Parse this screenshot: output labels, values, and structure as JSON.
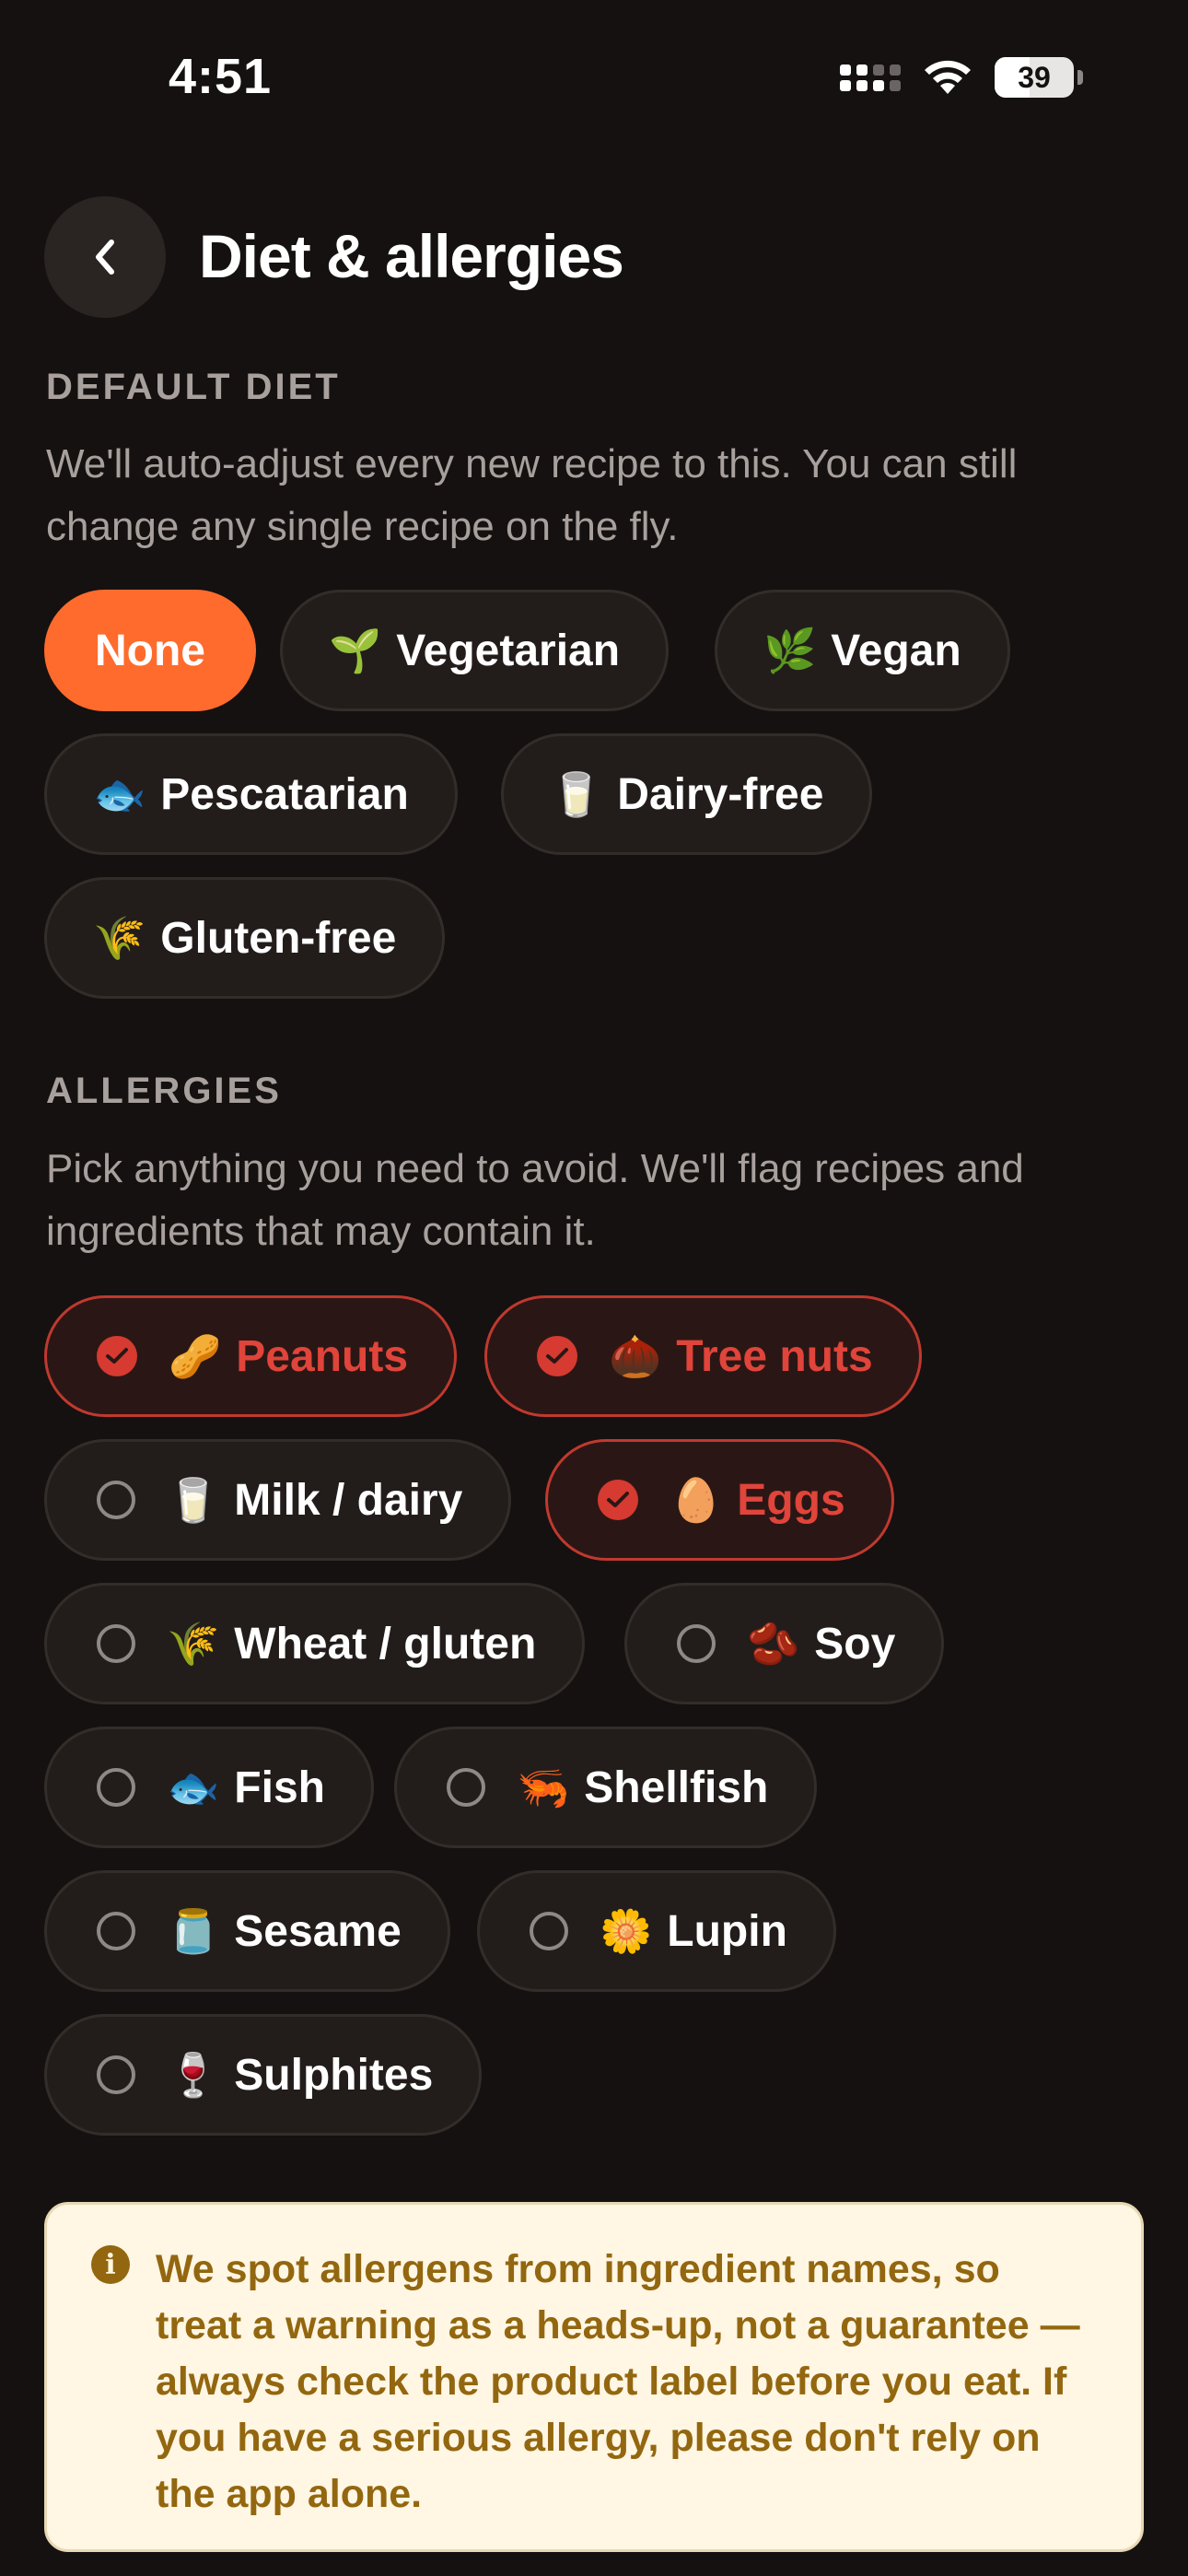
{
  "status_bar": {
    "time": "4:51",
    "battery": "39"
  },
  "header": {
    "title": "Diet & allergies",
    "back_icon": "chevron-left-icon"
  },
  "diet": {
    "label": "DEFAULT DIET",
    "description": "We'll auto-adjust every new recipe to this. You can still change any single recipe on the fly.",
    "options": [
      {
        "label": "None",
        "emoji": "",
        "selected": true
      },
      {
        "label": "Vegetarian",
        "emoji": "🌱",
        "selected": false
      },
      {
        "label": "Vegan",
        "emoji": "🌿",
        "selected": false
      },
      {
        "label": "Pescatarian",
        "emoji": "🐟",
        "selected": false
      },
      {
        "label": "Dairy-free",
        "emoji": "🥛",
        "selected": false
      },
      {
        "label": "Gluten-free",
        "emoji": "🌾",
        "selected": false
      }
    ]
  },
  "allergies": {
    "label": "ALLERGIES",
    "description": "Pick anything you need to avoid. We'll flag recipes and ingredients that may contain it.",
    "options": [
      {
        "label": "Peanuts",
        "emoji": "🥜",
        "checked": true
      },
      {
        "label": "Tree nuts",
        "emoji": "🌰",
        "checked": true
      },
      {
        "label": "Milk / dairy",
        "emoji": "🥛",
        "checked": false
      },
      {
        "label": "Eggs",
        "emoji": "🥚",
        "checked": true
      },
      {
        "label": "Wheat / gluten",
        "emoji": "🌾",
        "checked": false
      },
      {
        "label": "Soy",
        "emoji": "🫘",
        "checked": false
      },
      {
        "label": "Fish",
        "emoji": "🐟",
        "checked": false
      },
      {
        "label": "Shellfish",
        "emoji": "🦐",
        "checked": false
      },
      {
        "label": "Sesame",
        "emoji": "🫙",
        "checked": false
      },
      {
        "label": "Lupin",
        "emoji": "🌼",
        "checked": false
      },
      {
        "label": "Sulphites",
        "emoji": "🍷",
        "checked": false
      }
    ]
  },
  "note": {
    "icon": "info-icon",
    "text": "We spot allergens from ingredient names, so treat a warning as a heads-up, not a guarantee — always check the product label before you eat. If you have a serious allergy, please don't rely on the app alone."
  },
  "colors": {
    "background": "#151110",
    "accent": "#ff6b2c",
    "allergy_selected": "#e0443a",
    "note_bg": "#fff6e3",
    "note_text": "#93670f"
  }
}
